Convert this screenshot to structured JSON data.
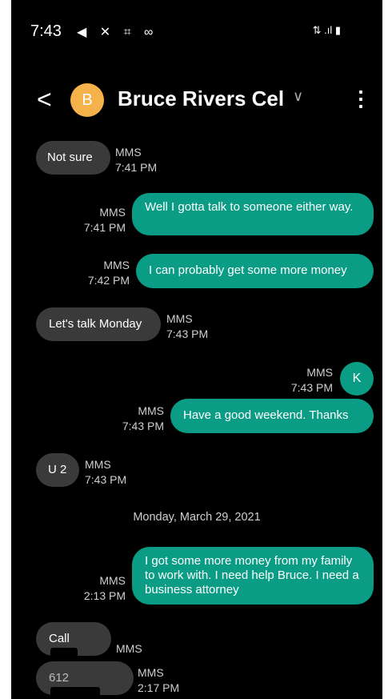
{
  "status_bar": {
    "time": "7:43",
    "left_icons": "◀ ✕ ⌗ ∞",
    "right_icons": "⇅ .ıl ▮"
  },
  "header": {
    "back_glyph": "<",
    "avatar_letter": "B",
    "contact_name": "Bruce Rivers Cel",
    "dropdown_glyph": "∨",
    "more_glyph": "⋮",
    "avatar_color": "#f6b24a"
  },
  "messages": [
    {
      "dir": "in",
      "text": "Not sure",
      "type": "MMS",
      "time": "7:41 PM"
    },
    {
      "dir": "out",
      "text": "Well I gotta talk to someone either way.",
      "type": "MMS",
      "time": "7:41 PM"
    },
    {
      "dir": "out",
      "text": "I can probably get some more money",
      "type": "MMS",
      "time": "7:42 PM"
    },
    {
      "dir": "in",
      "text": "Let's talk Monday",
      "type": "MMS",
      "time": "7:43 PM"
    },
    {
      "dir": "out",
      "text": "K",
      "type": "MMS",
      "time": "7:43 PM"
    },
    {
      "dir": "out",
      "text": "Have a good weekend.  Thanks",
      "type": "MMS",
      "time": "7:43 PM"
    },
    {
      "dir": "in",
      "text": "U 2",
      "type": "MMS",
      "time": "7:43 PM"
    },
    {
      "dir": "out",
      "text": "I got some more money from my family to work with.  I need help Bruce. I need a business attorney",
      "type": "MMS",
      "time": "2:13 PM"
    },
    {
      "dir": "in",
      "text": "Call",
      "type": "MMS",
      "time": ""
    },
    {
      "dir": "in",
      "text": "612",
      "type": "MMS",
      "time": "2:17 PM"
    }
  ],
  "date_divider": "Monday, March 29, 2021",
  "colors": {
    "background": "#000000",
    "incoming_bubble": "#3a3a3a",
    "outgoing_bubble": "#0a9c84",
    "meta_text": "#cfcfcf"
  }
}
